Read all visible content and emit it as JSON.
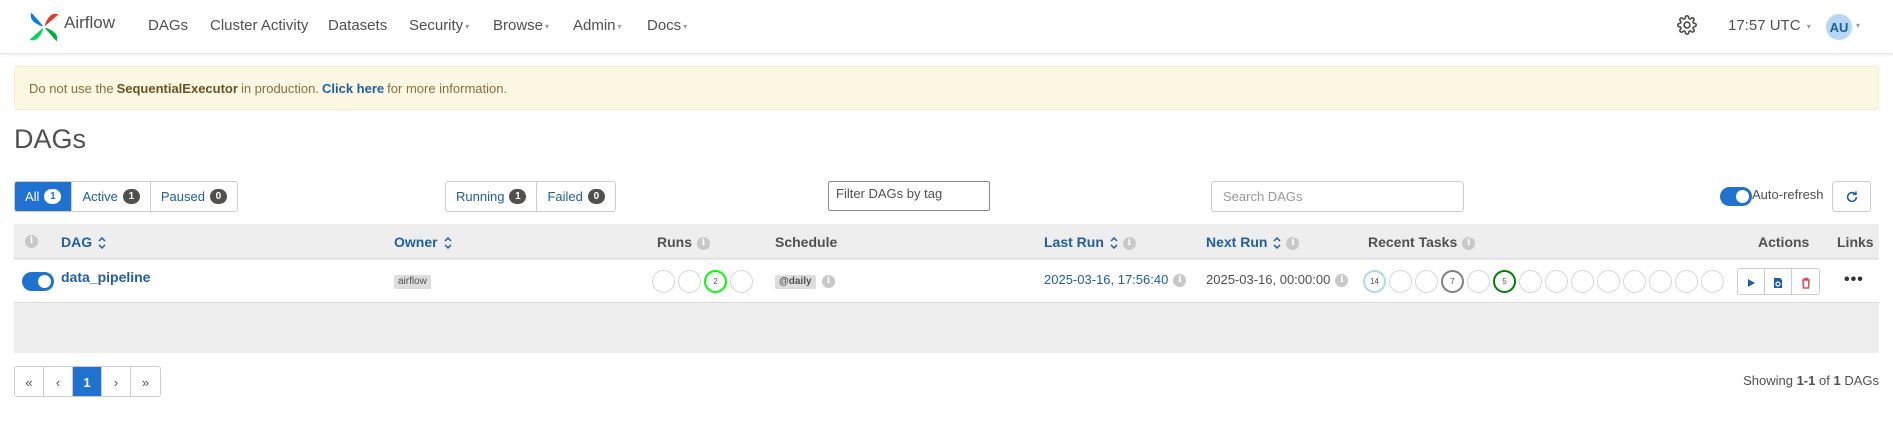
{
  "navbar": {
    "brand": "Airflow",
    "items": [
      {
        "label": "DAGs",
        "dropdown": false
      },
      {
        "label": "Cluster Activity",
        "dropdown": false
      },
      {
        "label": "Datasets",
        "dropdown": false
      },
      {
        "label": "Security",
        "dropdown": true
      },
      {
        "label": "Browse",
        "dropdown": true
      },
      {
        "label": "Admin",
        "dropdown": true
      },
      {
        "label": "Docs",
        "dropdown": true
      }
    ],
    "time": "17:57 UTC",
    "user_initials": "AU"
  },
  "alert": {
    "prefix": "Do not use the",
    "executor": "SequentialExecutor",
    "middle": "in production.",
    "link": "Click here",
    "suffix": "for more information."
  },
  "page_title": "DAGs",
  "status_filters": [
    {
      "label": "All",
      "count": "1",
      "active": true
    },
    {
      "label": "Active",
      "count": "1",
      "active": false
    },
    {
      "label": "Paused",
      "count": "0",
      "active": false
    }
  ],
  "run_filters": [
    {
      "label": "Running",
      "count": "1"
    },
    {
      "label": "Failed",
      "count": "0"
    }
  ],
  "tag_filter_placeholder": "Filter DAGs by tag",
  "search_placeholder": "Search DAGs",
  "auto_refresh_label": "Auto-refresh",
  "table": {
    "headers": {
      "dag": "DAG",
      "owner": "Owner",
      "runs": "Runs",
      "schedule": "Schedule",
      "last_run": "Last Run",
      "next_run": "Next Run",
      "recent_tasks": "Recent Tasks",
      "actions": "Actions",
      "links": "Links"
    },
    "rows": [
      {
        "dag_id": "data_pipeline",
        "paused": false,
        "owner": "airflow",
        "runs": [
          "",
          "",
          "2",
          ""
        ],
        "runs_colors": [
          "#d6d6d6",
          "#d6d6d6",
          "#00ff00",
          "#d6d6d6"
        ],
        "schedule": "@daily",
        "last_run": "2025-03-16, 17:56:40",
        "next_run": "2025-03-16, 00:00:00",
        "recent_tasks": [
          "14",
          "",
          "",
          "7",
          "",
          "5",
          "",
          "",
          "",
          "",
          "",
          "",
          "",
          ""
        ],
        "recent_tasks_colors": [
          "#add8e6",
          "#d6d6d6",
          "#d6d6d6",
          "#808080",
          "#d6d6d6",
          "#008000",
          "#d6d6d6",
          "#d6d6d6",
          "#d6d6d6",
          "#d6d6d6",
          "#d6d6d6",
          "#d6d6d6",
          "#d6d6d6",
          "#d6d6d6"
        ]
      }
    ]
  },
  "pagination": {
    "first": "«",
    "prev": "‹",
    "current": "1",
    "next": "›",
    "last": "»"
  },
  "showing": {
    "prefix": "Showing",
    "range": "1-1",
    "of": "of",
    "total": "1",
    "suffix": "DAGs"
  },
  "colors": {
    "primary": "#1f72d0",
    "link": "#1f5fa0",
    "alert_bg": "#fcf8e3"
  }
}
